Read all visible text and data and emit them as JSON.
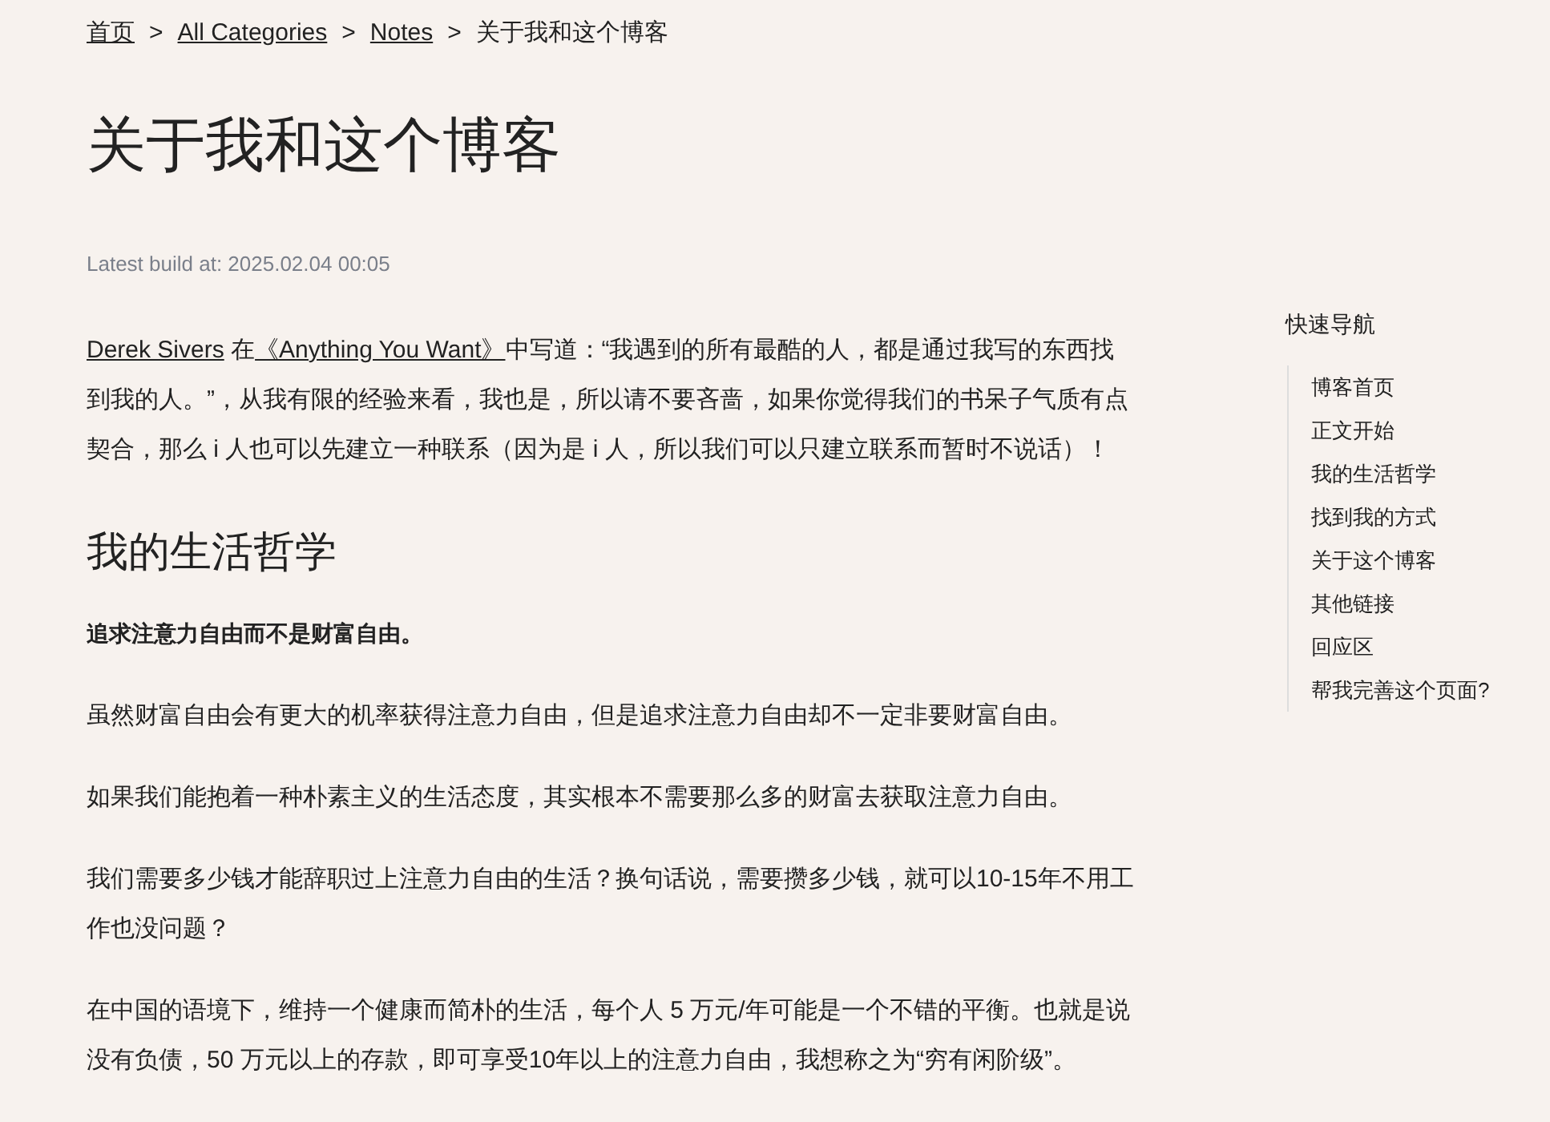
{
  "breadcrumb": [
    {
      "label": "首页",
      "kind": "link"
    },
    {
      "label": "All Categories",
      "kind": "link"
    },
    {
      "label": "Notes",
      "kind": "link"
    },
    {
      "label": "关于我和这个博客",
      "kind": "current"
    }
  ],
  "breadcrumb_separator": ">",
  "title": "关于我和这个博客",
  "build_info": "Latest build at: 2025.02.04 00:05",
  "content": [
    {
      "kind": "paragraph",
      "parts": [
        {
          "text": "Derek Sivers",
          "kind": "link"
        },
        {
          "text": " 在",
          "kind": "text"
        },
        {
          "text": "《Anything You Want》",
          "kind": "link"
        },
        {
          "text": "中写道：“我遇到的所有最酷的人，都是通过我写的东西找到我的人。”，从我有限的经验来看，我也是，所以请不要吝啬，如果你觉得我们的书呆子气质有点契合，那么 i 人也可以先建立一种联系（因为是 i 人，所以我们可以只建立联系而暂时不说话）！",
          "kind": "text"
        }
      ]
    },
    {
      "kind": "heading",
      "text": "我的生活哲学"
    },
    {
      "kind": "strong",
      "text": "追求注意力自由而不是财富自由。"
    },
    {
      "kind": "paragraph",
      "parts": [
        {
          "text": "虽然财富自由会有更大的机率获得注意力自由，但是追求注意力自由却不一定非要财富自由。",
          "kind": "text"
        }
      ]
    },
    {
      "kind": "paragraph",
      "parts": [
        {
          "text": "如果我们能抱着一种朴素主义的生活态度，其实根本不需要那么多的财富去获取注意力自由。",
          "kind": "text"
        }
      ]
    },
    {
      "kind": "paragraph",
      "parts": [
        {
          "text": "我们需要多少钱才能辞职过上注意力自由的生活？换句话说，需要攒多少钱，就可以10-15年不用工作也没问题？",
          "kind": "text"
        }
      ]
    },
    {
      "kind": "paragraph",
      "parts": [
        {
          "text": "在中国的语境下，维持一个健康而简朴的生活，每个人 5 万元/年可能是一个不错的平衡。也就是说没有负债，50 万元以上的存款，即可享受10年以上的注意力自由，我想称之为“穷有闲阶级”。",
          "kind": "text"
        }
      ]
    }
  ],
  "toc": {
    "title": "快速导航",
    "items": [
      "博客首页",
      "正文开始",
      "我的生活哲学",
      "找到我的方式",
      "关于这个博客",
      "其他链接",
      "回应区",
      "帮我完善这个页面?"
    ]
  }
}
